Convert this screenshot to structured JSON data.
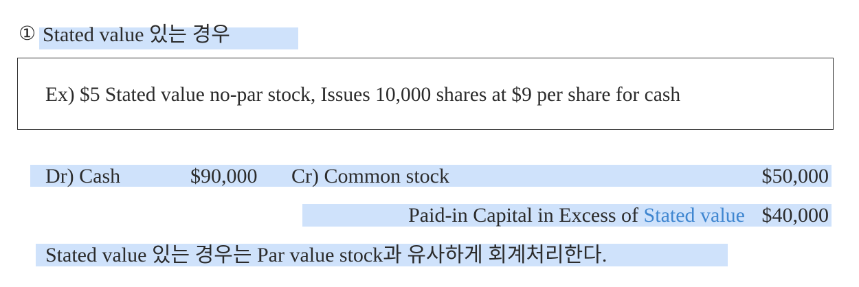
{
  "section": {
    "marker": "①",
    "heading": "Stated value 있는 경우"
  },
  "example": {
    "text": "Ex) $5 Stated value no-par stock, Issues 10,000 shares at $9 per share for cash"
  },
  "journal": {
    "line1": {
      "debit_label": "Dr) Cash",
      "debit_amount": "$90,000",
      "credit_label": "Cr) Common stock",
      "credit_amount": "$50,000"
    },
    "line2": {
      "credit_label_prefix": "Paid-in Capital in Excess of",
      "credit_label_highlight": "Stated value",
      "credit_amount": "$40,000"
    }
  },
  "conclusion": {
    "text": "Stated value 있는 경우는 Par value stock과 유사하게 회계처리한다."
  },
  "colors": {
    "highlight": "#cfe2fb",
    "link_blue": "#3f86d0",
    "text": "#2b2b2b"
  }
}
